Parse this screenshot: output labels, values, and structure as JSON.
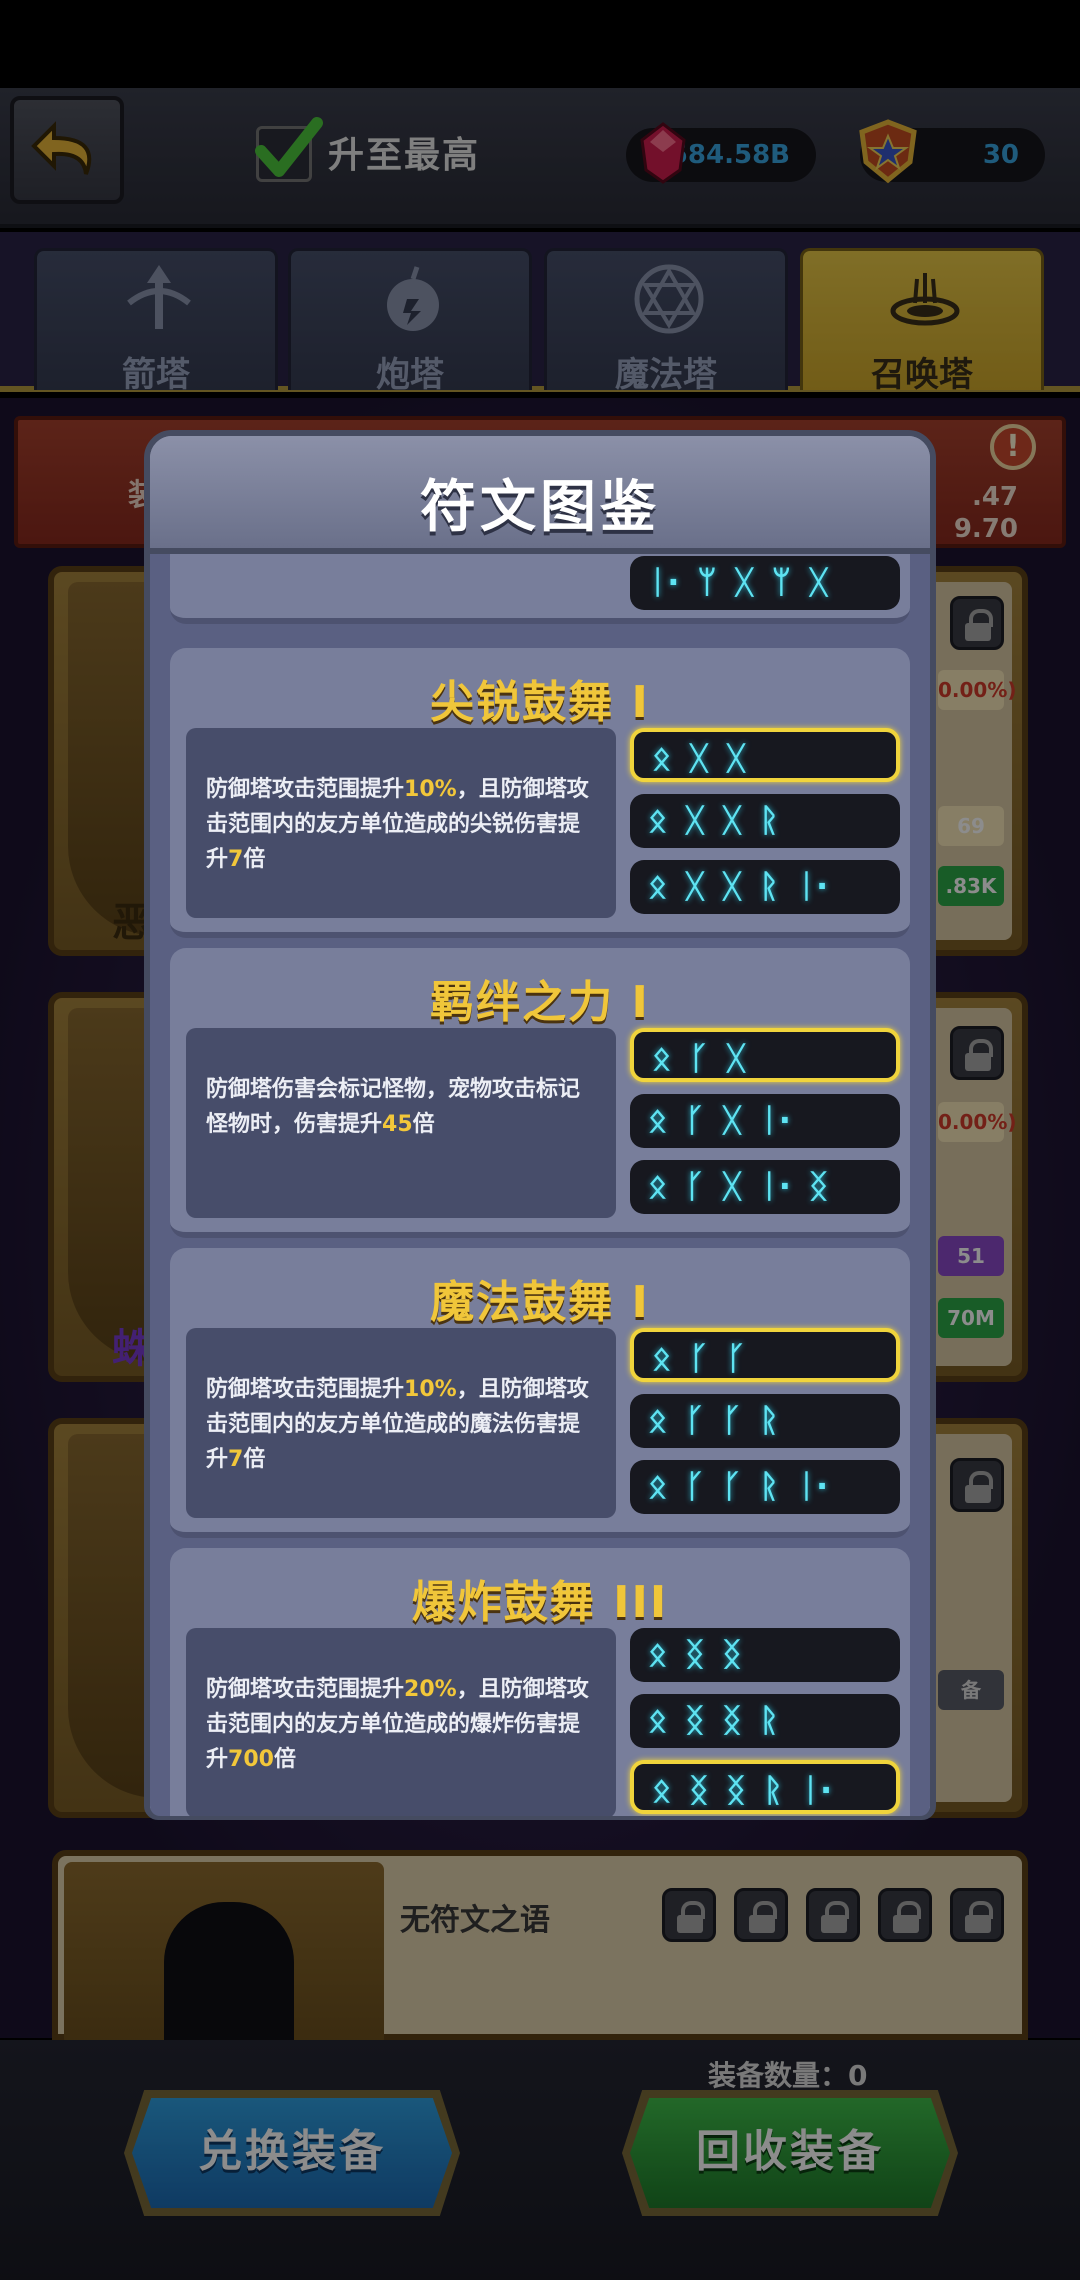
{
  "header": {
    "upgrade_label": "升至最高",
    "gems": "584.58B",
    "medals": "30"
  },
  "tabs": [
    {
      "label": "箭塔",
      "active": false
    },
    {
      "label": "炮塔",
      "active": false
    },
    {
      "label": "魔法塔",
      "active": false
    },
    {
      "label": "召唤塔",
      "active": true
    }
  ],
  "background": {
    "banner_char": "装",
    "banner_num_1": ".47",
    "banner_num_2": "9.70",
    "card1_name": "恶",
    "card1_chip_pct": "0.00%)",
    "card1_chip_num": "69",
    "card1_chip_green": ".83K",
    "card2_name": "蛛",
    "card2_chip_pct": "0.00%)",
    "card2_chip_num": "51",
    "card2_chip_green": "70M",
    "card3_chip": "备",
    "no_rune": "无符文之语",
    "equip_count": "装备数量：0"
  },
  "footer": {
    "exchange_label": "兑换装备",
    "recycle_label": "回收装备"
  },
  "modal": {
    "title": "符文图鉴",
    "partial_row_glyphs": [
      "ᛁ·",
      "ᛘ",
      "ᚷ",
      "ᛘ",
      "ᚷ"
    ],
    "runes": [
      {
        "title": "尖锐鼓舞 I",
        "desc": [
          "防御塔攻击范围提升",
          "10%",
          "，且防御塔攻击范围内的友方单位造成的尖锐伤害提升",
          "7",
          "倍"
        ],
        "rows": [
          {
            "glyphs": [
              "ᛟ",
              "ᚷ",
              "ᚷ"
            ],
            "selected": true
          },
          {
            "glyphs": [
              "ᛟ",
              "ᚷ",
              "ᚷ",
              "ᚱ"
            ],
            "selected": false
          },
          {
            "glyphs": [
              "ᛟ",
              "ᚷ",
              "ᚷ",
              "ᚱ",
              "ᛁ·"
            ],
            "selected": false
          }
        ]
      },
      {
        "title": "羁绊之力 I",
        "desc": [
          "防御塔伤害会标记怪物，宠物攻击标记怪物时，伤害提升",
          "45",
          "倍",
          "",
          ""
        ],
        "rows": [
          {
            "glyphs": [
              "ᛟ",
              "ᚴ",
              "ᚷ"
            ],
            "selected": true
          },
          {
            "glyphs": [
              "ᛟ",
              "ᚴ",
              "ᚷ",
              "ᛁ·"
            ],
            "selected": false
          },
          {
            "glyphs": [
              "ᛟ",
              "ᚴ",
              "ᚷ",
              "ᛁ·",
              "ᛝ"
            ],
            "selected": false
          }
        ]
      },
      {
        "title": "魔法鼓舞 I",
        "desc": [
          "防御塔攻击范围提升",
          "10%",
          "，且防御塔攻击范围内的友方单位造成的魔法伤害提升",
          "7",
          "倍"
        ],
        "rows": [
          {
            "glyphs": [
              "ᛟ",
              "ᚴ",
              "ᚴ"
            ],
            "selected": true
          },
          {
            "glyphs": [
              "ᛟ",
              "ᚴ",
              "ᚴ",
              "ᚱ"
            ],
            "selected": false
          },
          {
            "glyphs": [
              "ᛟ",
              "ᚴ",
              "ᚴ",
              "ᚱ",
              "ᛁ·"
            ],
            "selected": false
          }
        ]
      },
      {
        "title": "爆炸鼓舞 III",
        "desc": [
          "防御塔攻击范围提升",
          "20%",
          "，且防御塔攻击范围内的友方单位造成的爆炸伤害提升",
          "700",
          "倍"
        ],
        "rows": [
          {
            "glyphs": [
              "ᛟ",
              "ᛝ",
              "ᛝ"
            ],
            "selected": false
          },
          {
            "glyphs": [
              "ᛟ",
              "ᛝ",
              "ᛝ",
              "ᚱ"
            ],
            "selected": false
          },
          {
            "glyphs": [
              "ᛟ",
              "ᛝ",
              "ᛝ",
              "ᚱ",
              "ᛁ·"
            ],
            "selected": true
          }
        ]
      }
    ]
  }
}
